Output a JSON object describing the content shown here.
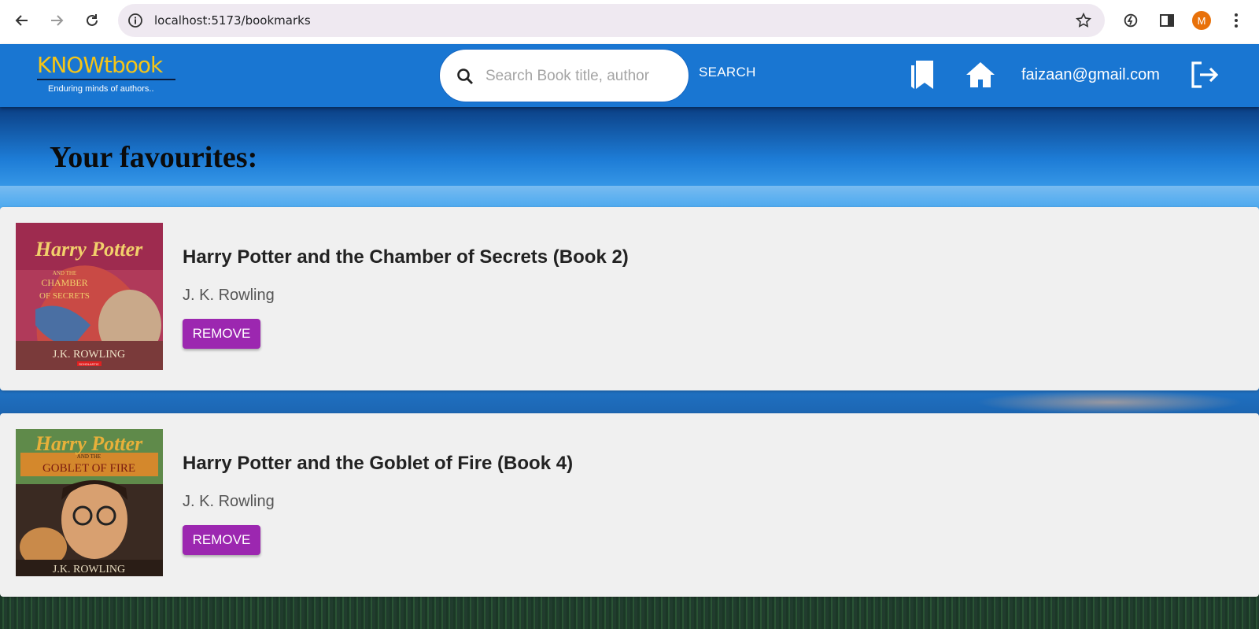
{
  "browser": {
    "url": "localhost:5173/bookmarks",
    "profile_initial": "M"
  },
  "header": {
    "logo_text": "KNOWtbook",
    "logo_tagline": "Enduring minds of authors..",
    "search_placeholder": "Search Book title, author",
    "search_button": "SEARCH",
    "user_email": "faizaan@gmail.com"
  },
  "main": {
    "heading": "Your favourites:",
    "bookmarks": [
      {
        "title": "Harry Potter and the Chamber of Secrets (Book 2)",
        "author": "J. K. Rowling",
        "remove_label": "REMOVE",
        "cover": {
          "title_line1": "Harry Potter",
          "title_line2": "AND THE",
          "title_line3": "CHAMBER",
          "title_line4": "OF SECRETS",
          "author": "J.K. ROWLING",
          "publisher": "SCHOLASTIC"
        }
      },
      {
        "title": "Harry Potter and the Goblet of Fire (Book 4)",
        "author": "J. K. Rowling",
        "remove_label": "REMOVE",
        "cover": {
          "title_line1": "Harry Potter",
          "title_line2": "AND THE",
          "title_line3": "GOBLET OF FIRE",
          "author": "J.K. ROWLING"
        }
      }
    ]
  },
  "colors": {
    "appbar": "#1976d2",
    "remove_button": "#9c27b0",
    "card_background": "#f0f0f0",
    "logo_text": "#f5c518"
  },
  "icons": [
    "back-arrow-icon",
    "forward-arrow-icon",
    "reload-icon",
    "site-info-icon",
    "bookmark-star-icon",
    "extensions-icon",
    "side-panel-icon",
    "menu-dots-icon",
    "search-icon",
    "bookmarks-icon",
    "home-icon",
    "logout-icon"
  ]
}
